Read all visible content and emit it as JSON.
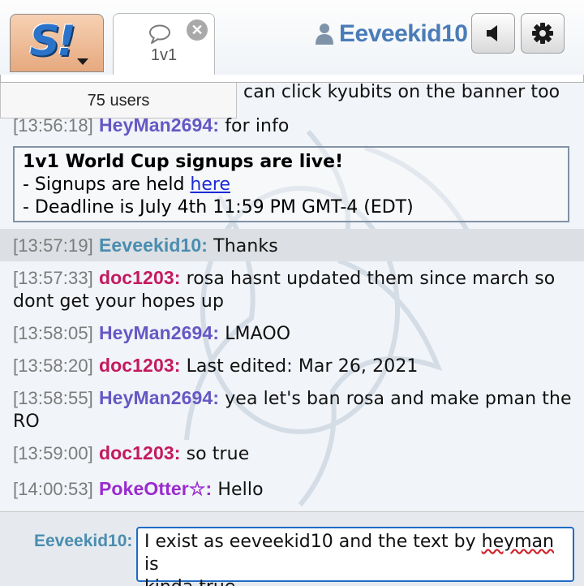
{
  "header": {
    "logo_text": "S!",
    "room_tab": {
      "label": "1v1",
      "icon": "chat-bubble-icon",
      "close_icon": "close-icon"
    },
    "user": {
      "name": "Eeveekid10",
      "icon": "user-icon"
    },
    "buttons": {
      "sound_icon": "speaker-icon",
      "options_icon": "gear-icon"
    },
    "accent": "#4a7cb8"
  },
  "userlist": {
    "label": "75 users"
  },
  "chat": {
    "fragment": "can click kyubits on the banner too",
    "messages_top": [
      {
        "time": "[13:56:18]",
        "user": "HeyMan2694:",
        "text": "for info"
      }
    ],
    "notice": {
      "title": "1v1 World Cup signups are live!",
      "line1_prefix": "- Signups are held ",
      "line1_link": "here",
      "line2": "- Deadline is July 4th 11:59 PM GMT-4 (EDT)"
    },
    "messages": [
      {
        "time": "[13:57:19]",
        "user": "Eeveekid10:",
        "text": "Thanks"
      },
      {
        "time": "[13:57:33]",
        "user": "doc1203:",
        "text": "rosa hasnt updated them since march so",
        "text2": "dont get your hopes up"
      },
      {
        "time": "[13:58:05]",
        "user": "HeyMan2694:",
        "text": "LMAOO"
      },
      {
        "time": "[13:58:20]",
        "user": "doc1203:",
        "text": "Last edited: Mar 26, 2021"
      },
      {
        "time": "[13:58:55]",
        "user": "HeyMan2694:",
        "text": "yea let's ban rosa and make pman the",
        "text2": "RO"
      },
      {
        "time": "[13:59:00]",
        "user": "doc1203:",
        "text": "so true"
      },
      {
        "time": "[14:00:53]",
        "user": "PokeOtter☆:",
        "text": "Hello"
      }
    ],
    "name_colors": {
      "HeyMan2694": "#6757c4",
      "Eeveekid10": "#4a8db0",
      "doc1203": "#c4195f",
      "PokeOtter": "#9a2ad0"
    }
  },
  "input": {
    "username": "Eeveekid10:",
    "text_part1": "I exist as eeveekid10 and the text by ",
    "text_misspelled": "heyman",
    "text_part2": " is",
    "text_line2_part1": "kinda ",
    "text_line2_underlined": "true",
    "focus_color": "#1e6cc6"
  }
}
